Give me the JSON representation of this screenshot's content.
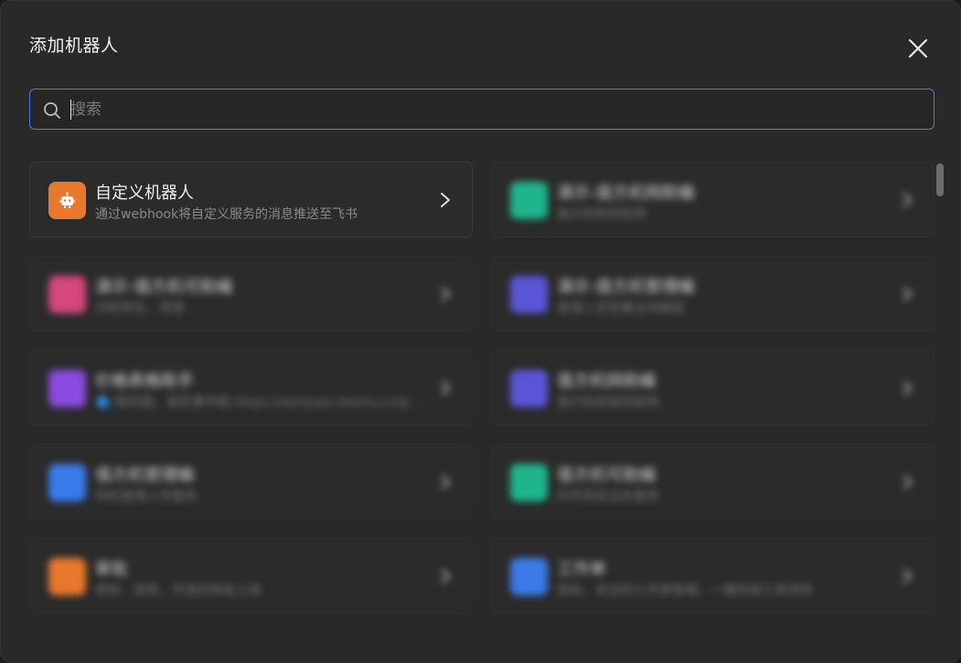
{
  "dialog": {
    "title": "添加机器人",
    "close_icon": "close-icon"
  },
  "search": {
    "placeholder": "搜索",
    "value": "",
    "icon": "search-icon"
  },
  "bots": [
    {
      "name": "自定义机器人",
      "desc": "通过webhook将自定义服务的消息推送至飞书",
      "color": "#e8782e",
      "icon": "robot-icon"
    },
    {
      "name": "演示-值方机网助编",
      "desc": "值方机网员助用",
      "color": "#1fb58c",
      "icon": "app-icon"
    },
    {
      "name": "演示-值方机可助编",
      "desc": "问到师生、范保",
      "color": "#d4487c",
      "icon": "app-icon"
    },
    {
      "name": "演示-值方机管理编",
      "desc": "管理人员签署全体服管",
      "color": "#5a55d6",
      "icon": "app-icon"
    },
    {
      "name": "价格表格助手",
      "desc": "🔷 数同值，复机事件能 https://wenjuan.feishu.cn/p...",
      "color": "#8a4be0",
      "icon": "app-icon"
    },
    {
      "name": "值方机网助编",
      "desc": "值方机机网员助用",
      "color": "#5a55d6",
      "icon": "app-icon"
    },
    {
      "name": "值方机管理编",
      "desc": "同机管理人员服务",
      "color": "#3a7bea",
      "icon": "app-icon"
    },
    {
      "name": "值方机可助编",
      "desc": "同专民机业务服务",
      "color": "#1fb58c",
      "icon": "app-icon"
    },
    {
      "name": "审批",
      "desc": "简体、高效、开放的审批工具",
      "color": "#e8782e",
      "icon": "approval-icon"
    },
    {
      "name": "工作单",
      "desc": "简体、安全的工作单管理、一键完成工单流转",
      "color": "#3a7bea",
      "icon": "ticket-icon"
    }
  ]
}
